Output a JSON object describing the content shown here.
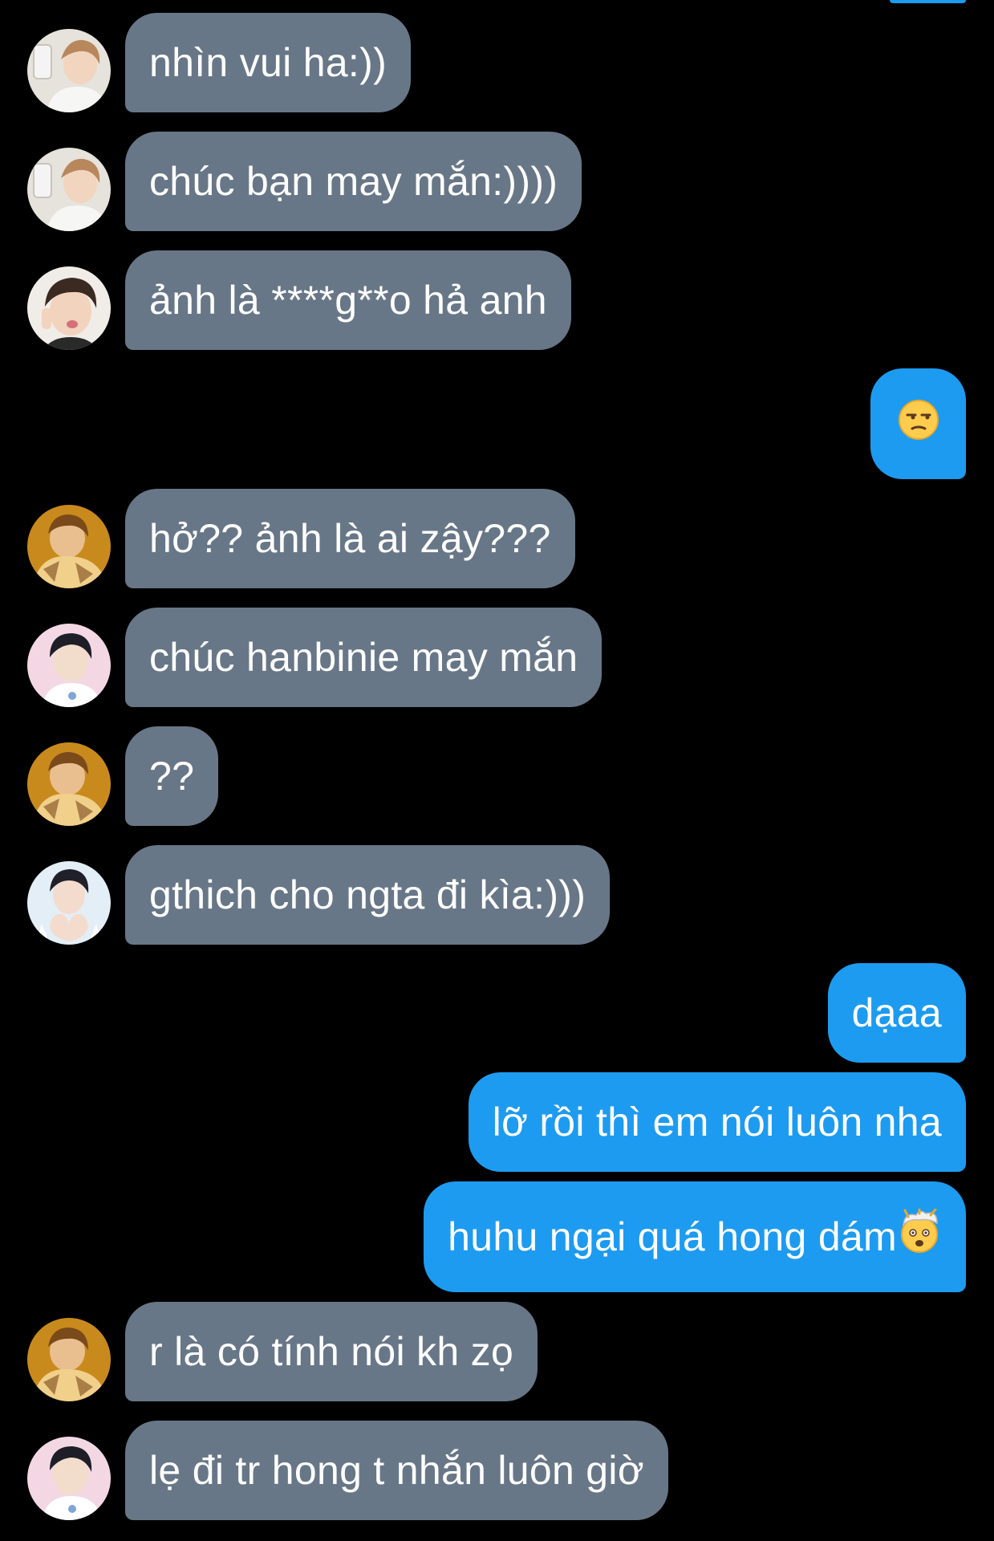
{
  "conversation": {
    "messages": [
      {
        "side": "in",
        "avatar": "avatar-boy-selfie",
        "text": "nhìn vui ha:))"
      },
      {
        "side": "in",
        "avatar": "avatar-boy-selfie",
        "text": "chúc bạn may mắn:))))"
      },
      {
        "side": "in",
        "avatar": "avatar-boy-pout",
        "text": "ảnh là ****g**o hả anh"
      },
      {
        "side": "out",
        "emoji": "unamused-face-emoji",
        "text": ""
      },
      {
        "side": "in",
        "avatar": "avatar-yellow-hoodie",
        "text": "hở?? ảnh là ai zậy???"
      },
      {
        "side": "in",
        "avatar": "avatar-pink-background",
        "text": "chúc hanbinie may mắn"
      },
      {
        "side": "in",
        "avatar": "avatar-yellow-hoodie",
        "text": "??"
      },
      {
        "side": "in",
        "avatar": "avatar-heart-hands",
        "text": "gthich cho ngta đi kìa:)))"
      },
      {
        "side": "out",
        "text": "dạaa"
      },
      {
        "side": "out",
        "text": "lỡ rồi thì em nói luôn nha"
      },
      {
        "side": "out",
        "emoji": "exploding-head-emoji",
        "text": "huhu ngại quá hong dám"
      },
      {
        "side": "in",
        "avatar": "avatar-yellow-hoodie",
        "text": "r là có tính nói kh zọ"
      },
      {
        "side": "in",
        "avatar": "avatar-pink-background",
        "text": "lẹ đi tr hong t nhắn luôn giờ"
      }
    ]
  },
  "colors": {
    "background": "#000000",
    "incoming_bubble": "#687787",
    "outgoing_bubble": "#1d9bf0",
    "text": "#ffffff"
  }
}
